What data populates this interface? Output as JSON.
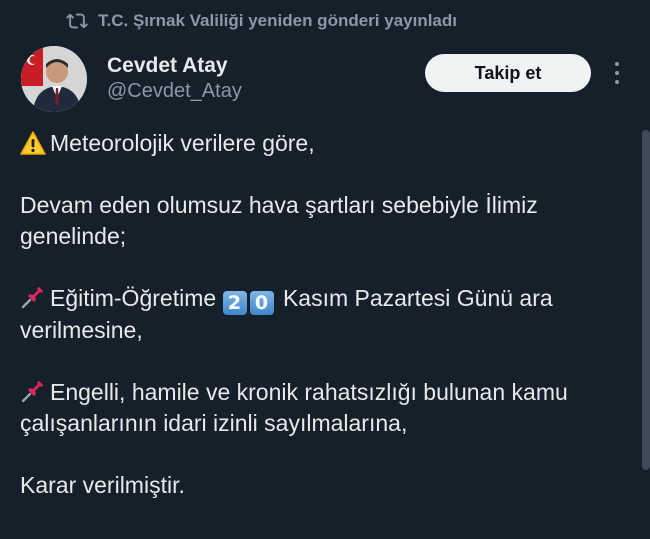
{
  "retweet": {
    "text": "T.C. Şırnak Valiliği yeniden gönderi yayınladı",
    "icon": "retweet-icon"
  },
  "author": {
    "name": "Cevdet Atay",
    "handle": "@Cevdet_Atay",
    "avatar_icon": "avatar-photo"
  },
  "follow_button": {
    "label": "Takip et"
  },
  "more_menu": {
    "icon": "more-vertical-icon"
  },
  "tweet": {
    "line1": "Meteorolojik verilere göre,",
    "line2": "Devam eden  olumsuz hava şartları sebebiyle İlimiz genelinde;",
    "line3_prefix": "Eğitim-Öğretime",
    "key1": "2",
    "key2": "0",
    "line3_suffix": "Kasım Pazartesi Günü ara verilmesine,",
    "line4": "Engelli, hamile ve kronik rahatsızlığı bulunan kamu çalışanlarının idari izinli sayılmalarına,",
    "line5": "Karar verilmiştir."
  },
  "colors": {
    "background": "#15202b",
    "text": "#e7e9ea",
    "muted": "#8b98a5",
    "button_bg": "#eff3f4"
  }
}
